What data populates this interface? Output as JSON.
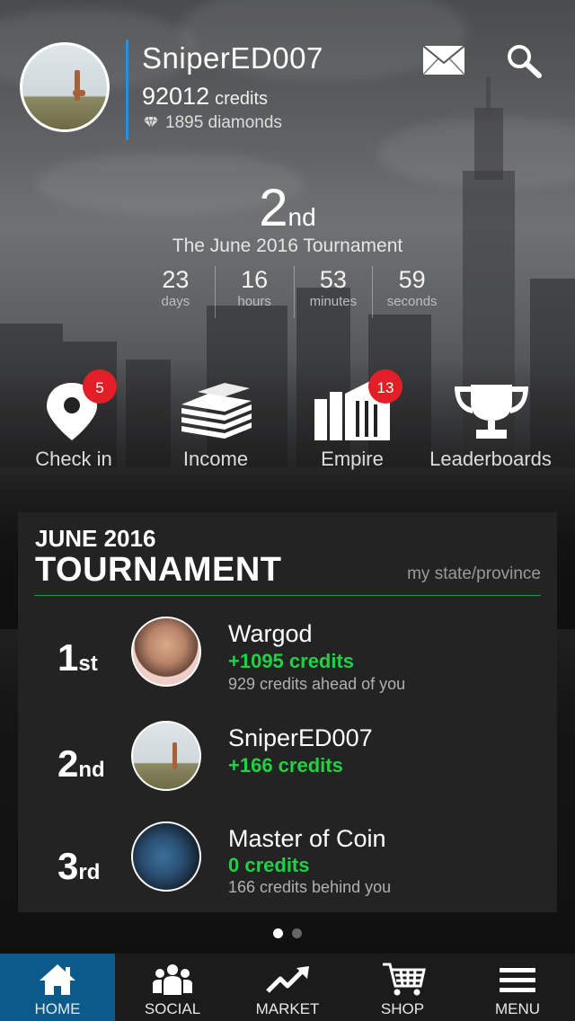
{
  "profile": {
    "username": "SniperED007",
    "credits_value": "92012",
    "credits_unit": "credits",
    "diamonds_text": "1895 diamonds"
  },
  "rank": {
    "number": "2",
    "suffix": "nd",
    "tournament_title": "The June 2016 Tournament"
  },
  "countdown": [
    {
      "value": "23",
      "label": "days"
    },
    {
      "value": "16",
      "label": "hours"
    },
    {
      "value": "53",
      "label": "minutes"
    },
    {
      "value": "59",
      "label": "seconds"
    }
  ],
  "actions": [
    {
      "label": "Check in",
      "icon": "location-pin-icon",
      "badge": "5"
    },
    {
      "label": "Income",
      "icon": "money-stack-icon",
      "badge": ""
    },
    {
      "label": "Empire",
      "icon": "buildings-icon",
      "badge": "13"
    },
    {
      "label": "Leaderboards",
      "icon": "trophy-icon",
      "badge": ""
    }
  ],
  "tournament_card": {
    "subtitle": "JUNE 2016",
    "title": "TOURNAMENT",
    "scope": "my state/province",
    "accent_color": "#1c9b3c",
    "entries": [
      {
        "place": "1",
        "suffix": "st",
        "name": "Wargod",
        "credits": "+1095 credits",
        "note": "929 credits ahead of you"
      },
      {
        "place": "2",
        "suffix": "nd",
        "name": "SniperED007",
        "credits": "+166 credits",
        "note": ""
      },
      {
        "place": "3",
        "suffix": "rd",
        "name": "Master of Coin",
        "credits": "0 credits",
        "note": "166 credits behind you"
      }
    ]
  },
  "pager": {
    "pages": 2,
    "active": 1
  },
  "nav": {
    "items": [
      {
        "label": "HOME",
        "icon": "home-icon",
        "active": true
      },
      {
        "label": "SOCIAL",
        "icon": "people-icon",
        "active": false
      },
      {
        "label": "MARKET",
        "icon": "trend-up-icon",
        "active": false
      },
      {
        "label": "SHOP",
        "icon": "cart-icon",
        "active": false
      },
      {
        "label": "MENU",
        "icon": "hamburger-menu-icon",
        "active": false
      }
    ]
  },
  "colors": {
    "accent_blue": "#2a8fd8",
    "badge_red": "#e21e26",
    "credit_green": "#22d046",
    "nav_active": "#0a5a8a"
  }
}
